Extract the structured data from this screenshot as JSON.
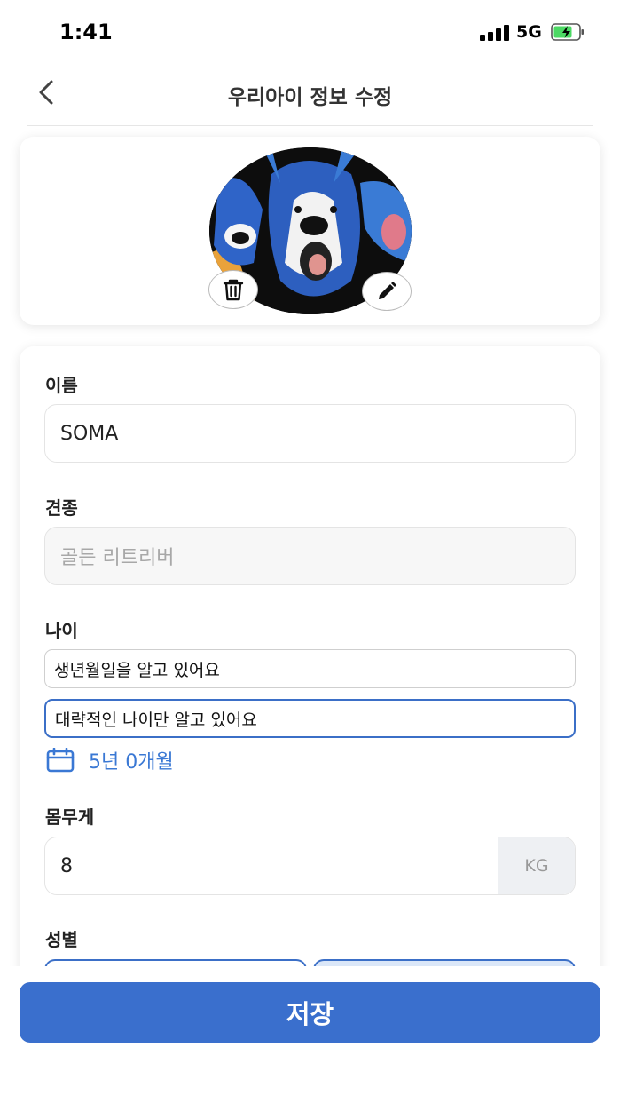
{
  "status": {
    "time": "1:41",
    "network": "5G"
  },
  "header": {
    "title": "우리아이 정보 수정"
  },
  "form": {
    "name_label": "이름",
    "name_value": "SOMA",
    "breed_label": "견종",
    "breed_placeholder": "골든 리트리버",
    "age_label": "나이",
    "age_option_birthdate": "생년월일을 알고 있어요",
    "age_option_approx": "대략적인 나이만 알고 있어요",
    "age_value": "5년 0개월",
    "weight_label": "몸무게",
    "weight_value": "8",
    "weight_unit": "KG",
    "gender_label": "성별"
  },
  "footer": {
    "save_label": "저장"
  },
  "colors": {
    "accent": "#3a6fcd",
    "link": "#3a78d4"
  }
}
